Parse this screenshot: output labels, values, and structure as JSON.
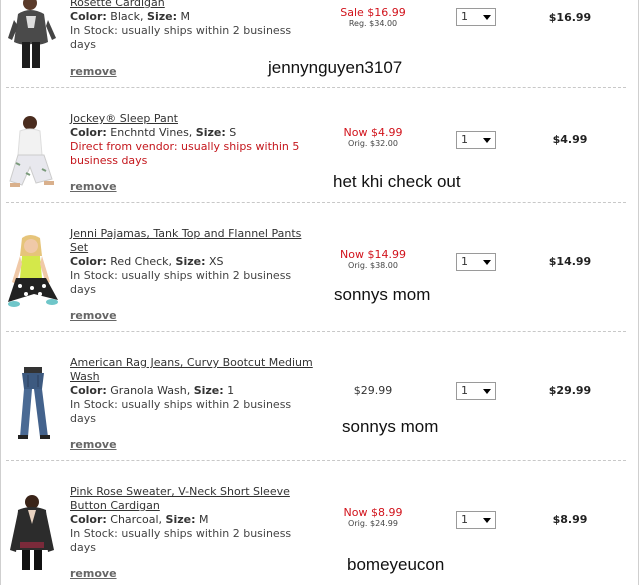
{
  "items": [
    {
      "name": "Rosette Cardigan",
      "color_label": "Color:",
      "color": "Black",
      "size_label": "Size:",
      "size": "M",
      "stock": "In Stock: usually ships within 2 business days",
      "remove": "remove",
      "price_main": "Sale $16.99",
      "price_orig": "Reg. $34.00",
      "qty": "1",
      "total": "$16.99"
    },
    {
      "name": "Jockey® Sleep Pant",
      "color_label": "Color:",
      "color": "Enchntd Vines",
      "size_label": "Size:",
      "size": "S",
      "stock": "Direct from vendor: usually ships within 5 business days",
      "remove": "remove",
      "price_main": "Now $4.99",
      "price_orig": "Orig. $32.00",
      "qty": "1",
      "total": "$4.99"
    },
    {
      "name": "Jenni Pajamas, Tank Top and Flannel Pants Set",
      "color_label": "Color:",
      "color": "Red Check",
      "size_label": "Size:",
      "size": "XS",
      "stock": "In Stock: usually ships within 2 business days",
      "remove": "remove",
      "price_main": "Now $14.99",
      "price_orig": "Orig. $38.00",
      "qty": "1",
      "total": "$14.99"
    },
    {
      "name": "American Rag Jeans, Curvy Bootcut Medium Wash",
      "color_label": "Color:",
      "color": "Granola Wash",
      "size_label": "Size:",
      "size": "1",
      "stock": "In Stock: usually ships within 2 business days",
      "remove": "remove",
      "price_main": "$29.99",
      "price_orig": "",
      "qty": "1",
      "total": "$29.99"
    },
    {
      "name": "Pink Rose Sweater, V-Neck Short Sleeve Button Cardigan",
      "color_label": "Color:",
      "color": "Charcoal",
      "size_label": "Size:",
      "size": "M",
      "stock": "In Stock: usually ships within 2 business days",
      "remove": "remove",
      "price_main": "Now $8.99",
      "price_orig": "Orig. $24.99",
      "qty": "1",
      "total": "$8.99"
    }
  ],
  "overlays": {
    "note1": "jennynguyen3107",
    "note2": "het khi check out",
    "note3": "sonnys mom",
    "note4": "sonnys mom",
    "note5": "bomeyeucon"
  },
  "colors": {
    "sale_red": "#d1121b",
    "vendor_red": "#c4161c",
    "separator": "#c8c8c8"
  }
}
